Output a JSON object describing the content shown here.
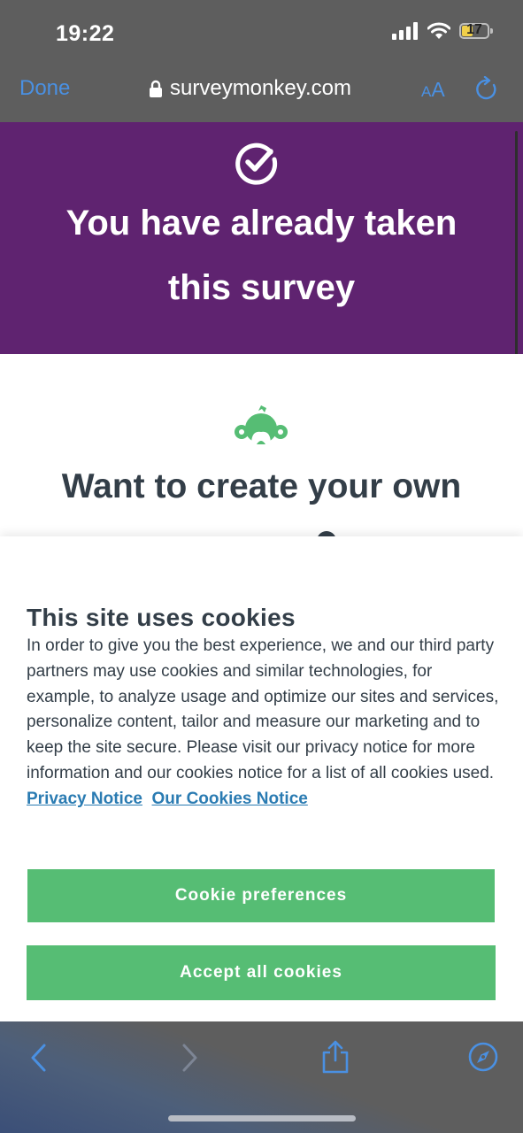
{
  "status_bar": {
    "time": "19:22",
    "battery": "17"
  },
  "browser": {
    "done_label": "Done",
    "url": "surveymonkey.com",
    "text_size_small": "A",
    "text_size_large": "A"
  },
  "banner": {
    "title": "You have already taken this survey"
  },
  "main": {
    "heading": "Want to create your own"
  },
  "cookie_notice": {
    "title": "This site uses cookies",
    "body": "In order to give you the best experience, we and our third party partners may use cookies and similar technologies, for example, to analyze usage and optimize our sites and services, personalize content, tailor and measure our marketing and to keep the site secure. Please visit our privacy notice for more information and our cookies notice for a list of all cookies used.",
    "privacy_link": "Privacy Notice",
    "cookies_link": "Our Cookies Notice",
    "preferences_button": "Cookie preferences",
    "accept_button": "Accept all cookies"
  },
  "colors": {
    "banner": "#5f2370",
    "button": "#56bd74",
    "link": "#2a7bb2",
    "ios_blue": "#4a90e2"
  },
  "icons": [
    "signal-icon",
    "wifi-icon",
    "battery-icon",
    "lock-icon",
    "reload-icon",
    "check-circle-icon",
    "surveymonkey-logo-icon",
    "back-icon",
    "forward-icon",
    "share-icon",
    "compass-icon"
  ]
}
